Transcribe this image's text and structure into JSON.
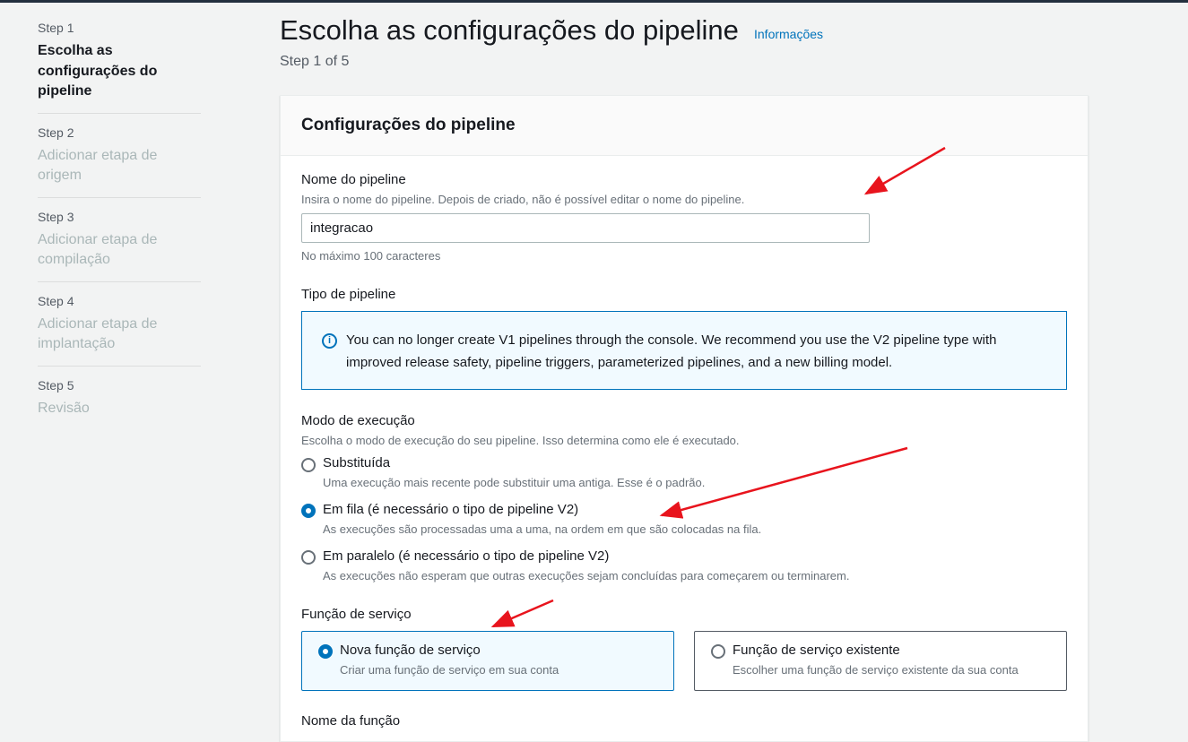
{
  "sidebar": {
    "steps": [
      {
        "num": "Step 1",
        "title": "Escolha as configurações do pipeline"
      },
      {
        "num": "Step 2",
        "title": "Adicionar etapa de origem"
      },
      {
        "num": "Step 3",
        "title": "Adicionar etapa de compilação"
      },
      {
        "num": "Step 4",
        "title": "Adicionar etapa de implantação"
      },
      {
        "num": "Step 5",
        "title": "Revisão"
      }
    ]
  },
  "header": {
    "title": "Escolha as configurações do pipeline",
    "info_link": "Informações",
    "step_indicator": "Step 1 of 5"
  },
  "panel": {
    "title": "Configurações do pipeline",
    "pipeline_name": {
      "label": "Nome do pipeline",
      "description": "Insira o nome do pipeline. Depois de criado, não é possível editar o nome do pipeline.",
      "value": "integracao",
      "constraint": "No máximo 100 caracteres"
    },
    "pipeline_type": {
      "label": "Tipo de pipeline",
      "info": "You can no longer create V1 pipelines through the console. We recommend you use the V2 pipeline type with improved release safety, pipeline triggers, parameterized pipelines, and a new billing model."
    },
    "execution_mode": {
      "label": "Modo de execução",
      "description": "Escolha o modo de execução do seu pipeline. Isso determina como ele é executado.",
      "options": [
        {
          "label": "Substituída",
          "description": "Uma execução mais recente pode substituir uma antiga. Esse é o padrão.",
          "selected": false
        },
        {
          "label": "Em fila (é necessário o tipo de pipeline V2)",
          "description": "As execuções são processadas uma a uma, na ordem em que são colocadas na fila.",
          "selected": true
        },
        {
          "label": "Em paralelo (é necessário o tipo de pipeline V2)",
          "description": "As execuções não esperam que outras execuções sejam concluídas para começarem ou terminarem.",
          "selected": false
        }
      ]
    },
    "service_role": {
      "label": "Função de serviço",
      "options": [
        {
          "label": "Nova função de serviço",
          "description": "Criar uma função de serviço em sua conta",
          "selected": true
        },
        {
          "label": "Função de serviço existente",
          "description": "Escolher uma função de serviço existente da sua conta",
          "selected": false
        }
      ]
    },
    "role_name": {
      "label": "Nome da função"
    }
  },
  "colors": {
    "accent": "#0073bb",
    "annotation": "#e8141d"
  },
  "icons": {
    "info": "info-icon"
  }
}
